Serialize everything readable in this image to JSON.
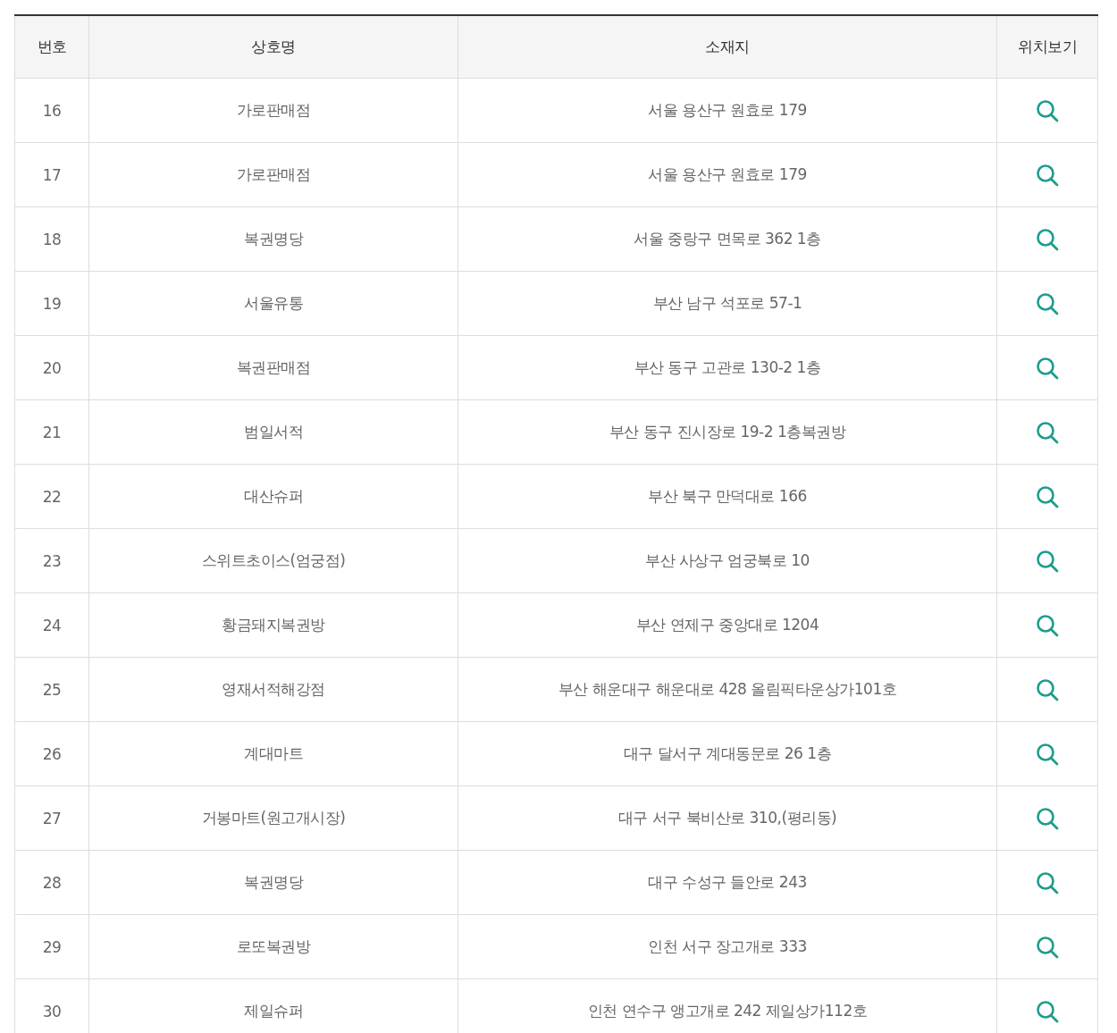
{
  "table": {
    "columns": [
      "번호",
      "상호명",
      "소재지",
      "위치보기"
    ],
    "rows": [
      {
        "no": "16",
        "name": "가로판매점",
        "address": "서울 용산구 원효로 179"
      },
      {
        "no": "17",
        "name": "가로판매점",
        "address": "서울 용산구 원효로 179"
      },
      {
        "no": "18",
        "name": "복권명당",
        "address": "서울 중랑구 면목로 362 1층"
      },
      {
        "no": "19",
        "name": "서울유통",
        "address": "부산 남구 석포로 57-1"
      },
      {
        "no": "20",
        "name": "복권판매점",
        "address": "부산 동구 고관로 130-2 1층"
      },
      {
        "no": "21",
        "name": "범일서적",
        "address": "부산 동구 진시장로 19-2 1층복권방"
      },
      {
        "no": "22",
        "name": "대산슈퍼",
        "address": "부산 북구 만덕대로 166"
      },
      {
        "no": "23",
        "name": "스위트초이스(엄궁점)",
        "address": "부산 사상구 엄궁북로 10"
      },
      {
        "no": "24",
        "name": "황금돼지복권방",
        "address": "부산 연제구 중앙대로 1204"
      },
      {
        "no": "25",
        "name": "영재서적해강점",
        "address": "부산 해운대구 해운대로 428 올림픽타운상가101호"
      },
      {
        "no": "26",
        "name": "계대마트",
        "address": "대구 달서구 계대동문로 26 1층"
      },
      {
        "no": "27",
        "name": "거봉마트(원고개시장)",
        "address": "대구 서구 북비산로 310,(평리동)"
      },
      {
        "no": "28",
        "name": "복권명당",
        "address": "대구 수성구 들안로 243"
      },
      {
        "no": "29",
        "name": "로또복권방",
        "address": "인천 서구 장고개로 333"
      },
      {
        "no": "30",
        "name": "제일슈퍼",
        "address": "인천 연수구 앵고개로 242 제일상가112호"
      }
    ]
  }
}
